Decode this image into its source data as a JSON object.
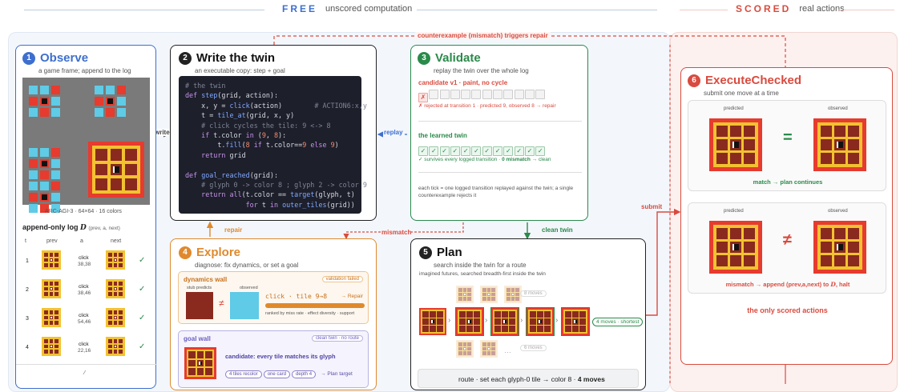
{
  "header": {
    "free_label": "FREE",
    "free_caption": "unscored computation",
    "scored_label": "SCORED",
    "scored_caption": "real actions"
  },
  "colors": {
    "free": "#3d6fcf",
    "scored": "#d94b3f",
    "validate": "#2a8a4a",
    "explore": "#e0892c",
    "goal": "#6a5fc1"
  },
  "connectors": {
    "counterexample": "counterexample (mismatch) triggers repair",
    "write": "write",
    "replay": "replay",
    "repair": "repair",
    "mismatch": "mismatch",
    "clean_twin": "clean twin",
    "submit": "submit"
  },
  "observe": {
    "num": "1",
    "title": "Observe",
    "subtitle": "a game frame; append to the log",
    "frame_caption": "ARC-AGI-3 · 64×64 · 16 colors",
    "log_title": "append-only log",
    "log_symbol": "D",
    "log_args": "(prev, a, next)",
    "cols": [
      "t",
      "prev",
      "a",
      "next"
    ],
    "rows": [
      {
        "t": "1",
        "a1": "click",
        "a2": "38,38",
        "check": "✓"
      },
      {
        "t": "2",
        "a1": "click",
        "a2": "38,46",
        "check": "✓"
      },
      {
        "t": "3",
        "a1": "click",
        "a2": "54,46",
        "check": "✓"
      },
      {
        "t": "4",
        "a1": "click",
        "a2": "22,16",
        "check": "✓"
      }
    ],
    "ellipsis": "⁄"
  },
  "twin": {
    "num": "2",
    "title": "Write the twin",
    "subtitle": "an executable copy: step + goal",
    "code": [
      "# the twin",
      "def step(grid, action):",
      "    x, y = click(action)        # ACTION6:x,y",
      "    t = tile_at(grid, x, y)",
      "    # click cycles the tile: 9 <-> 8",
      "    if t.color in (9, 8):",
      "        t.fill(8 if t.color==9 else 9)",
      "    return grid",
      "",
      "def goal_reached(grid):",
      "    # glyph 0 -> color 8 ; glyph 2 -> color 9",
      "    return all(t.color == target(glyph, t)",
      "               for t in outer_tiles(grid))"
    ]
  },
  "validate": {
    "num": "3",
    "title": "Validate",
    "subtitle": "replay the twin over the whole log",
    "candidate": "candidate v1 · paint, no cycle",
    "rejected": "✗ rejected at transition 1 · predicted 9, observed 8  → repair",
    "learned": "the learned twin",
    "survives": "✓ survives every logged transition · ",
    "survives_bold": "0 mismatch",
    "survives_end": " → clean",
    "note": "each tick = one logged transition replayed against the twin; a single counterexample rejects it",
    "fail_mark": "✗",
    "pass_mark": "✓"
  },
  "explore": {
    "num": "4",
    "title": "Explore",
    "subtitle": "diagnose: fix dynamics, or set a goal",
    "dyn_title": "dynamics wall",
    "dyn_badge": "validation failed",
    "stub": "stub predicts",
    "observed": "observed",
    "neq": "≠",
    "click_tile": "click · tile 9→8",
    "repair_arrow": "→ Repair",
    "ranked": "ranked by miss rate · effect diversity · support",
    "goal_title": "goal wall",
    "goal_badge": "clean twin · no route",
    "candidate": "candidate: every tile matches its glyph",
    "pills": [
      "4 tiles recolor",
      "one card",
      "depth 4"
    ],
    "plan_target": "→ Plan target"
  },
  "plan": {
    "num": "5",
    "title": "Plan",
    "subtitle": "search inside the twin for a route",
    "caption": "imagined futures, searched breadth-first inside the twin",
    "upper_moves": "8 moves",
    "lower_moves": "6 moves",
    "dots": "…",
    "shortest": "4 moves · shortest",
    "route": "route · set each glyph-0 tile → color 8 · ",
    "route_bold": "4 moves"
  },
  "execute": {
    "num": "6",
    "title": "ExecuteChecked",
    "subtitle": "submit one move at a time",
    "predicted": "predicted",
    "observed": "observed",
    "eq": "=",
    "neq": "≠",
    "match": "match → plan continues",
    "mismatch": "mismatch → append (prev,a,next) to ",
    "mismatch_sym": "D",
    "mismatch_end": ", halt",
    "only": "the only scored actions"
  }
}
